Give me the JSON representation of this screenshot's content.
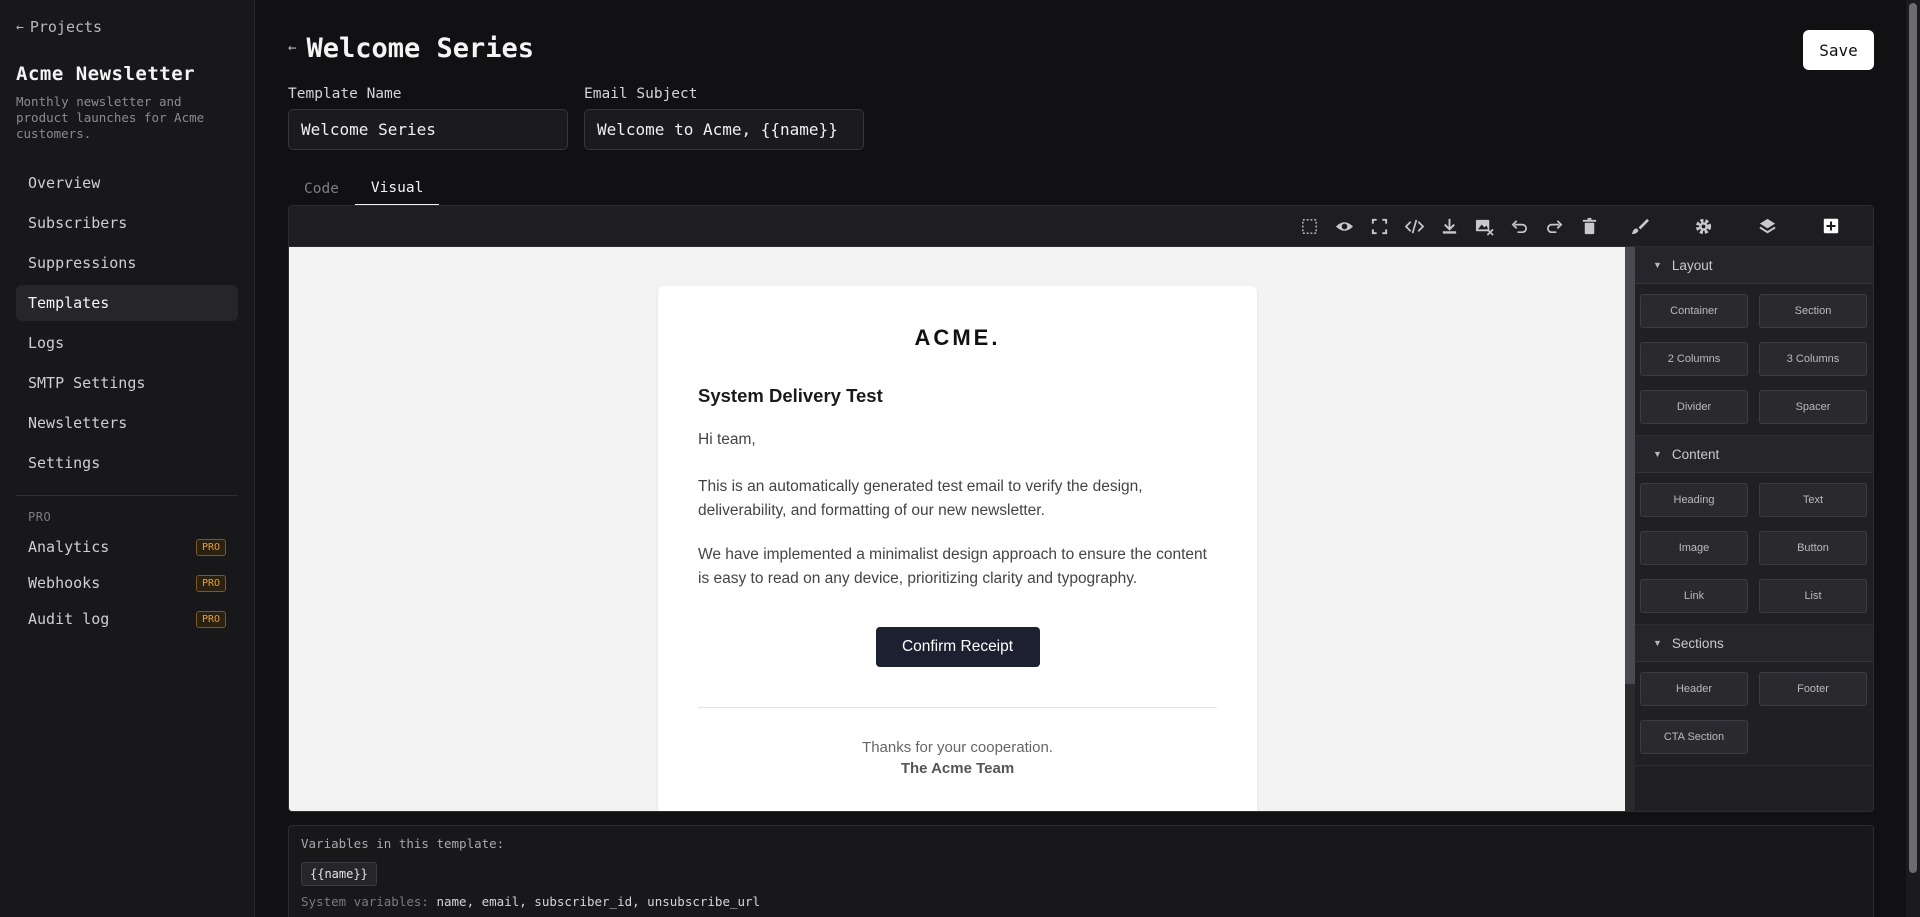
{
  "sidebar": {
    "back_label": "Projects",
    "project_title": "Acme Newsletter",
    "project_desc": "Monthly newsletter and product launches for Acme customers.",
    "items": [
      {
        "label": "Overview"
      },
      {
        "label": "Subscribers"
      },
      {
        "label": "Suppressions"
      },
      {
        "label": "Templates",
        "active": true
      },
      {
        "label": "Logs"
      },
      {
        "label": "SMTP Settings"
      },
      {
        "label": "Newsletters"
      },
      {
        "label": "Settings"
      }
    ],
    "pro_section": "PRO",
    "pro_items": [
      {
        "label": "Analytics",
        "badge": "PRO"
      },
      {
        "label": "Webhooks",
        "badge": "PRO"
      },
      {
        "label": "Audit log",
        "badge": "PRO"
      }
    ]
  },
  "header": {
    "title": "Welcome Series",
    "save_label": "Save"
  },
  "form": {
    "template_name_label": "Template Name",
    "template_name_value": "Welcome Series",
    "subject_label": "Email Subject",
    "subject_value": "Welcome to Acme, {{name}}"
  },
  "tabs": [
    {
      "label": "Code",
      "active": false
    },
    {
      "label": "Visual",
      "active": true
    }
  ],
  "toolbar": {
    "icons": [
      "select-outline-icon",
      "preview-eye-icon",
      "fullscreen-icon",
      "code-icon",
      "download-icon",
      "clear-image-icon",
      "undo-icon",
      "redo-icon",
      "trash-icon",
      "style-manager-brush-icon",
      "settings-gear-icon",
      "layers-icon",
      "add-block-icon"
    ]
  },
  "email": {
    "logo": "ACME.",
    "heading": "System Delivery Test",
    "greeting": "Hi team,",
    "paragraph1": "This is an automatically generated test email to verify the design, deliverability, and formatting of our new newsletter.",
    "paragraph2": "We have implemented a minimalist design approach to ensure the content is easy to read on any device, prioritizing clarity and typography.",
    "button_label": "Confirm Receipt",
    "thanks": "Thanks for your cooperation.",
    "signature": "The Acme Team"
  },
  "blocks": {
    "categories": [
      {
        "label": "Layout",
        "items": [
          "Container",
          "Section",
          "2 Columns",
          "3 Columns",
          "Divider",
          "Spacer"
        ]
      },
      {
        "label": "Content",
        "items": [
          "Heading",
          "Text",
          "Image",
          "Button",
          "Link",
          "List"
        ]
      },
      {
        "label": "Sections",
        "items": [
          "Header",
          "Footer",
          "CTA Section"
        ]
      }
    ]
  },
  "variables": {
    "title": "Variables in this template:",
    "chips": [
      "{{name}}"
    ],
    "system_label": "System variables:",
    "system_vars": "name, email, subscriber_id, unsubscribe_url"
  },
  "colors": {
    "background": "#111113",
    "sidebar": "#18181b",
    "pro_badge": "#e3a13b",
    "email_button": "#1c2030"
  }
}
